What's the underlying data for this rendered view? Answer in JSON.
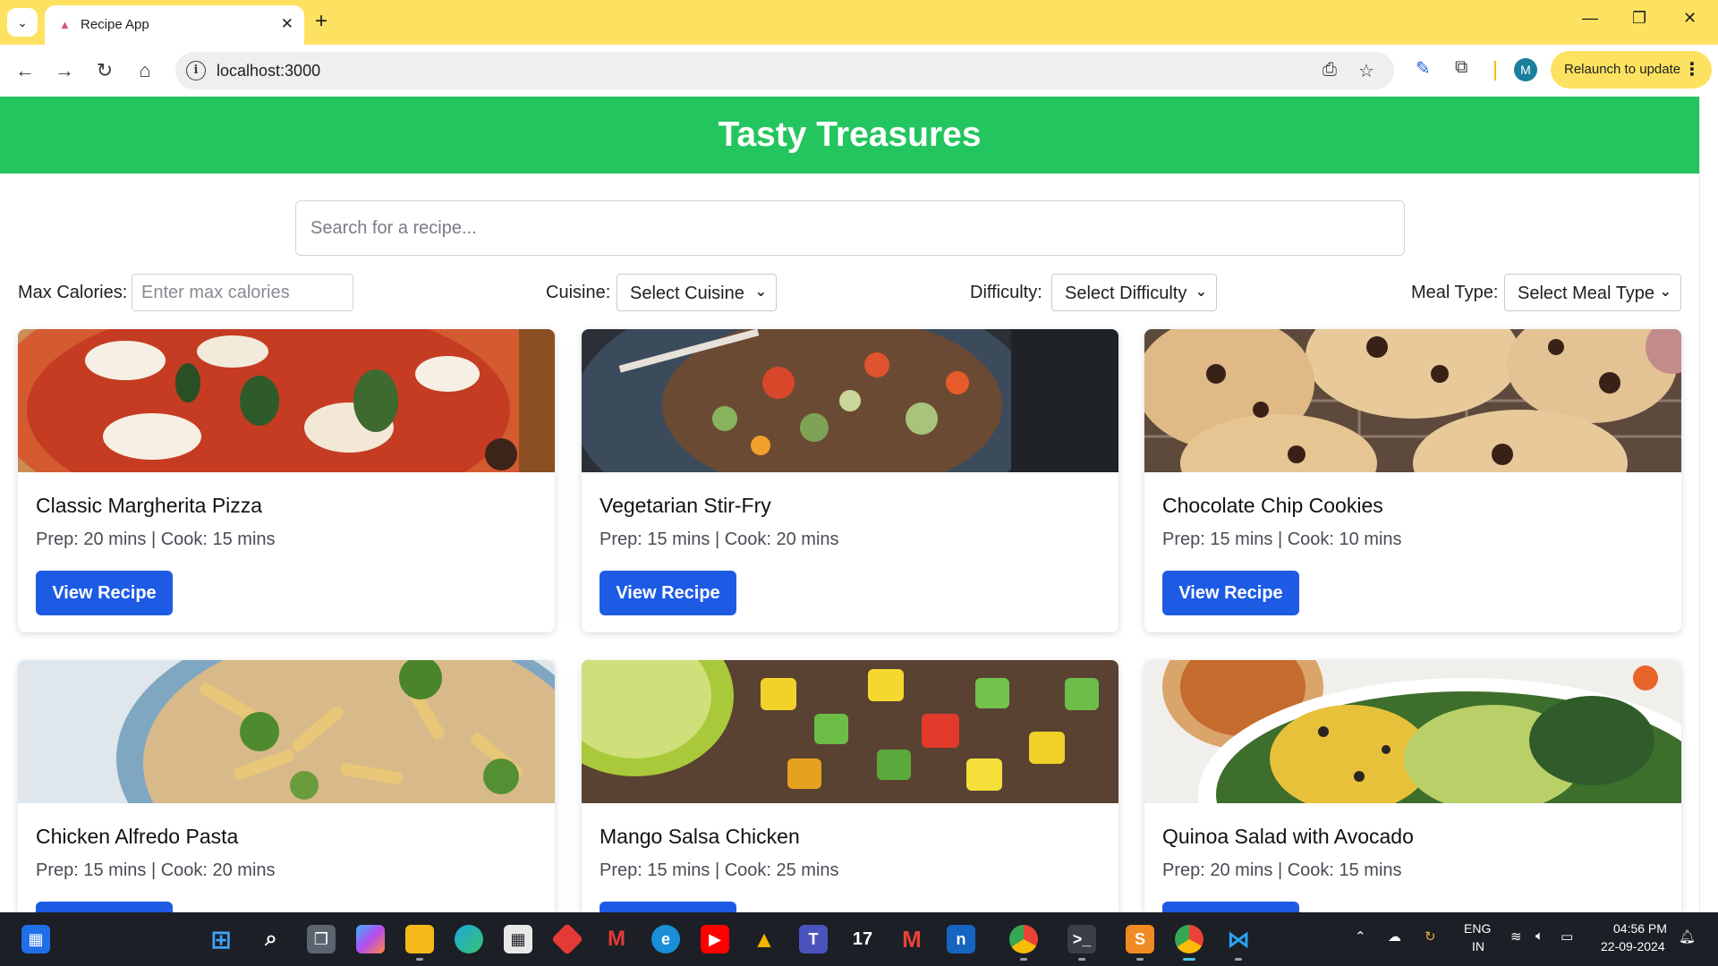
{
  "browser": {
    "tab_title": "Recipe App",
    "url": "localhost:3000",
    "profile_initial": "M",
    "relaunch_label": "Relaunch to update",
    "new_tab_symbol": "+",
    "close_symbol": "✕"
  },
  "app": {
    "title": "Tasty Treasures",
    "search_placeholder": "Search for a recipe...",
    "filters": {
      "max_calories_label": "Max Calories:",
      "max_calories_placeholder": "Enter max calories",
      "cuisine_label": "Cuisine:",
      "cuisine_value": "Select Cuisine",
      "difficulty_label": "Difficulty:",
      "difficulty_value": "Select Difficulty",
      "meal_type_label": "Meal Type:",
      "meal_type_value": "Select Meal Type"
    },
    "button_label": "View Recipe",
    "recipes": [
      {
        "name": "Classic Margherita Pizza",
        "meta": "Prep: 20 mins | Cook: 15 mins",
        "image": "pizza"
      },
      {
        "name": "Vegetarian Stir-Fry",
        "meta": "Prep: 15 mins | Cook: 20 mins",
        "image": "stir-fry"
      },
      {
        "name": "Chocolate Chip Cookies",
        "meta": "Prep: 15 mins | Cook: 10 mins",
        "image": "cookies"
      },
      {
        "name": "Chicken Alfredo Pasta",
        "meta": "Prep: 15 mins | Cook: 20 mins",
        "image": "pasta"
      },
      {
        "name": "Mango Salsa Chicken",
        "meta": "Prep: 15 mins | Cook: 25 mins",
        "image": "mango-salsa"
      },
      {
        "name": "Quinoa Salad with Avocado",
        "meta": "Prep: 20 mins | Cook: 15 mins",
        "image": "quinoa-salad"
      }
    ]
  },
  "colors": {
    "tabbar": "#fde262",
    "header": "#22c55e",
    "button": "#1d5be5",
    "taskbar": "#1c1f26"
  },
  "taskbar": {
    "lang_line1": "ENG",
    "lang_line2": "IN",
    "time": "04:56 PM",
    "date": "22-09-2024"
  }
}
